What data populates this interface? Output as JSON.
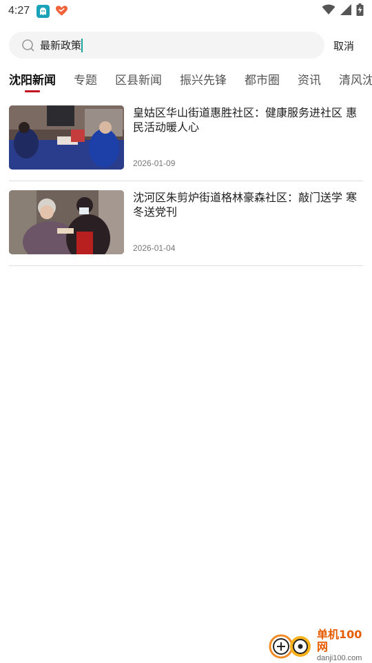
{
  "status_bar": {
    "time": "4:27",
    "app_icons": [
      "ghost-app-icon",
      "heart-app-icon"
    ],
    "icons": [
      "wifi-icon",
      "signal-icon",
      "battery-charging-icon"
    ]
  },
  "search": {
    "value": "最新政策",
    "cancel_label": "取消"
  },
  "tabs": [
    {
      "label": "沈阳新闻",
      "active": true
    },
    {
      "label": "专题",
      "active": false
    },
    {
      "label": "区县新闻",
      "active": false
    },
    {
      "label": "振兴先锋",
      "active": false
    },
    {
      "label": "都市圈",
      "active": false
    },
    {
      "label": "资讯",
      "active": false
    },
    {
      "label": "清风沈",
      "active": false
    }
  ],
  "news": [
    {
      "title": "皇姑区华山街道惠胜社区：健康服务进社区 惠民活动暖人心",
      "date": "2026-01-09"
    },
    {
      "title": "沈河区朱剪炉街道格林豪森社区：敲门送学 寒冬送党刊",
      "date": "2026-01-04"
    }
  ],
  "watermark": {
    "name": "单机100网",
    "url": "danji100.com"
  },
  "colors": {
    "accent_red": "#c1121f",
    "caret_teal": "#1aa39a",
    "search_bg": "#f4f4f4",
    "watermark_orange": "#e65c00"
  }
}
